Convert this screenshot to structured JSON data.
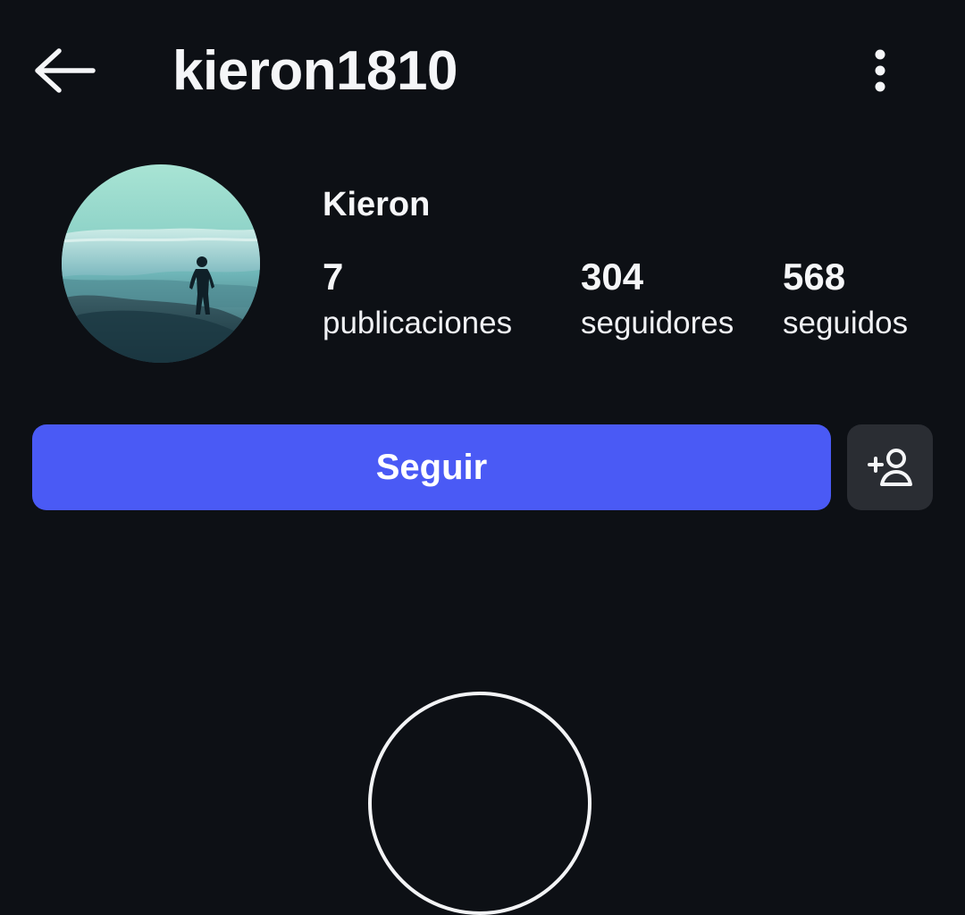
{
  "header": {
    "username": "kieron1810",
    "back_icon": "arrow-left-icon",
    "more_icon": "more-vertical-icon"
  },
  "profile": {
    "display_name": "Kieron",
    "avatar_icon": "profile-photo-silhouette",
    "stats": [
      {
        "value": "7",
        "label": "publicaciones"
      },
      {
        "value": "304",
        "label": "seguidores"
      },
      {
        "value": "568",
        "label": "seguidos"
      }
    ]
  },
  "actions": {
    "follow_label": "Seguir",
    "suggest_icon": "person-add-icon"
  },
  "colors": {
    "background": "#0d1015",
    "text": "#f5f6f8",
    "primary_button": "#4a5af5",
    "secondary_button": "#2a2d33"
  }
}
